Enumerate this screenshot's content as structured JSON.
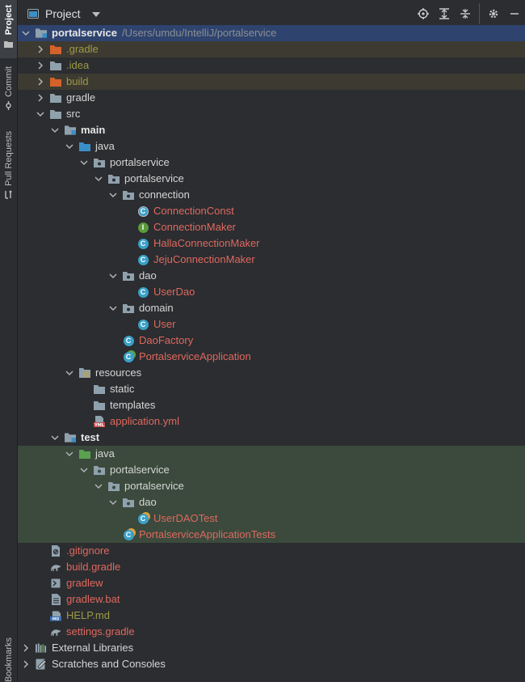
{
  "toolwindow": {
    "title": "Project",
    "side_tabs": [
      "Project",
      "Commit",
      "Pull Requests",
      "Bookmarks"
    ],
    "actions": [
      "locate-icon",
      "expand-all-icon",
      "collapse-all-icon",
      "gear-icon",
      "hide-icon"
    ]
  },
  "colors": {
    "background": "#2b2d30",
    "text": "#d6d6d6",
    "modified_text": "#e0685f",
    "excluded_text": "#9e9a44",
    "excluded_folder": "#d4622a",
    "source_folder": "#3b8fc7",
    "test_folder": "#5aa150",
    "test_bg": "#3b4a3c",
    "excluded_bg": "#3d3a32",
    "selected_bg": "#2e436e"
  },
  "tree": [
    {
      "label": "portalservice",
      "path": "/Users/umdu/IntelliJ/portalservice"
    },
    {
      "label": ".gradle"
    },
    {
      "label": ".idea"
    },
    {
      "label": "build"
    },
    {
      "label": "gradle"
    },
    {
      "label": "src"
    },
    {
      "label": "main"
    },
    {
      "label": "java"
    },
    {
      "label": "portalservice"
    },
    {
      "label": "portalservice"
    },
    {
      "label": "connection"
    },
    {
      "label": "ConnectionConst"
    },
    {
      "label": "ConnectionMaker"
    },
    {
      "label": "HallaConnectionMaker"
    },
    {
      "label": "JejuConnectionMaker"
    },
    {
      "label": "dao"
    },
    {
      "label": "UserDao"
    },
    {
      "label": "domain"
    },
    {
      "label": "User"
    },
    {
      "label": "DaoFactory"
    },
    {
      "label": "PortalserviceApplication"
    },
    {
      "label": "resources"
    },
    {
      "label": "static"
    },
    {
      "label": "templates"
    },
    {
      "label": "application.yml"
    },
    {
      "label": "test"
    },
    {
      "label": "java"
    },
    {
      "label": "portalservice"
    },
    {
      "label": "portalservice"
    },
    {
      "label": "dao"
    },
    {
      "label": "UserDAOTest"
    },
    {
      "label": "PortalserviceApplicationTests"
    },
    {
      "label": ".gitignore"
    },
    {
      "label": "build.gradle"
    },
    {
      "label": "gradlew"
    },
    {
      "label": "gradlew.bat"
    },
    {
      "label": "HELP.md"
    },
    {
      "label": "settings.gradle"
    },
    {
      "label": "External Libraries"
    },
    {
      "label": "Scratches and Consoles"
    }
  ]
}
